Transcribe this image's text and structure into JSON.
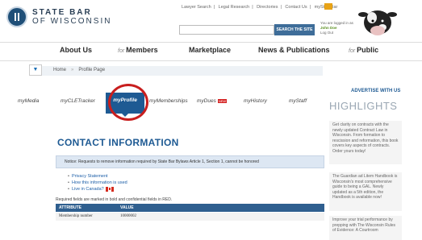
{
  "header": {
    "logo_line1": "STATE BAR",
    "logo_line2": "OF WISCONSIN",
    "top_links": [
      "Lawyer Search",
      "Legal Research",
      "Directories",
      "Contact Us",
      "myStateBar"
    ],
    "search_button": "SEARCH THE SITE",
    "search_placeholder": "",
    "logged_in_label": "You are logged in as",
    "user_name": "John Doe",
    "logout": "Log Out"
  },
  "main_nav": {
    "items": [
      {
        "label": "About Us"
      },
      {
        "prefix": "for",
        "label": "Members"
      },
      {
        "label": "Marketplace"
      },
      {
        "label": "News & Publications"
      },
      {
        "prefix": "for",
        "label": "Public"
      }
    ]
  },
  "breadcrumb": [
    "Home",
    "Profile Page"
  ],
  "sub_tabs": [
    {
      "label": "myMedia"
    },
    {
      "label": "myCLETracker"
    },
    {
      "label": "myProfile",
      "active": true
    },
    {
      "label": "myMemberships"
    },
    {
      "label": "myDues",
      "badge": "NEW"
    },
    {
      "label": "myHistory"
    },
    {
      "label": "myStaff"
    }
  ],
  "content": {
    "title": "CONTACT INFORMATION",
    "notice": "Notice: Requests to remove information required by State Bar Bylaws Article 1, Section 1, cannot be honored",
    "links": [
      "Privacy Statement",
      "How this information is used",
      "Live in Canada?"
    ],
    "required_note": "Required fields are marked in bold and confidential fields in RED.",
    "table": {
      "headers": [
        "ATTRIBUTE",
        "VALUE"
      ],
      "rows": [
        [
          "Membership number",
          "10000002"
        ]
      ]
    }
  },
  "sidebar": {
    "advertise": "ADVERTISE WITH US",
    "highlights_title": "HIGHLIGHTS",
    "items": [
      "Get clarity on contracts with the newly updated Contract Law in Wisconsin. From formation to rescission and reformation, this book covers key aspects of contracts. Order yours today!",
      "The Guardian ad Litem Handbook is Wisconsin's most comprehensive guide to being a GAL. Newly updated as a 5th edition, the Handbook is available now!",
      "Improve your trial performance by prepping with The Wisconsin Rules of Evidence: A Courtroom"
    ]
  },
  "colors": {
    "brand": "#1e5a93",
    "highlight_circle": "#c81e1e",
    "search_button": "#3e6d99"
  }
}
